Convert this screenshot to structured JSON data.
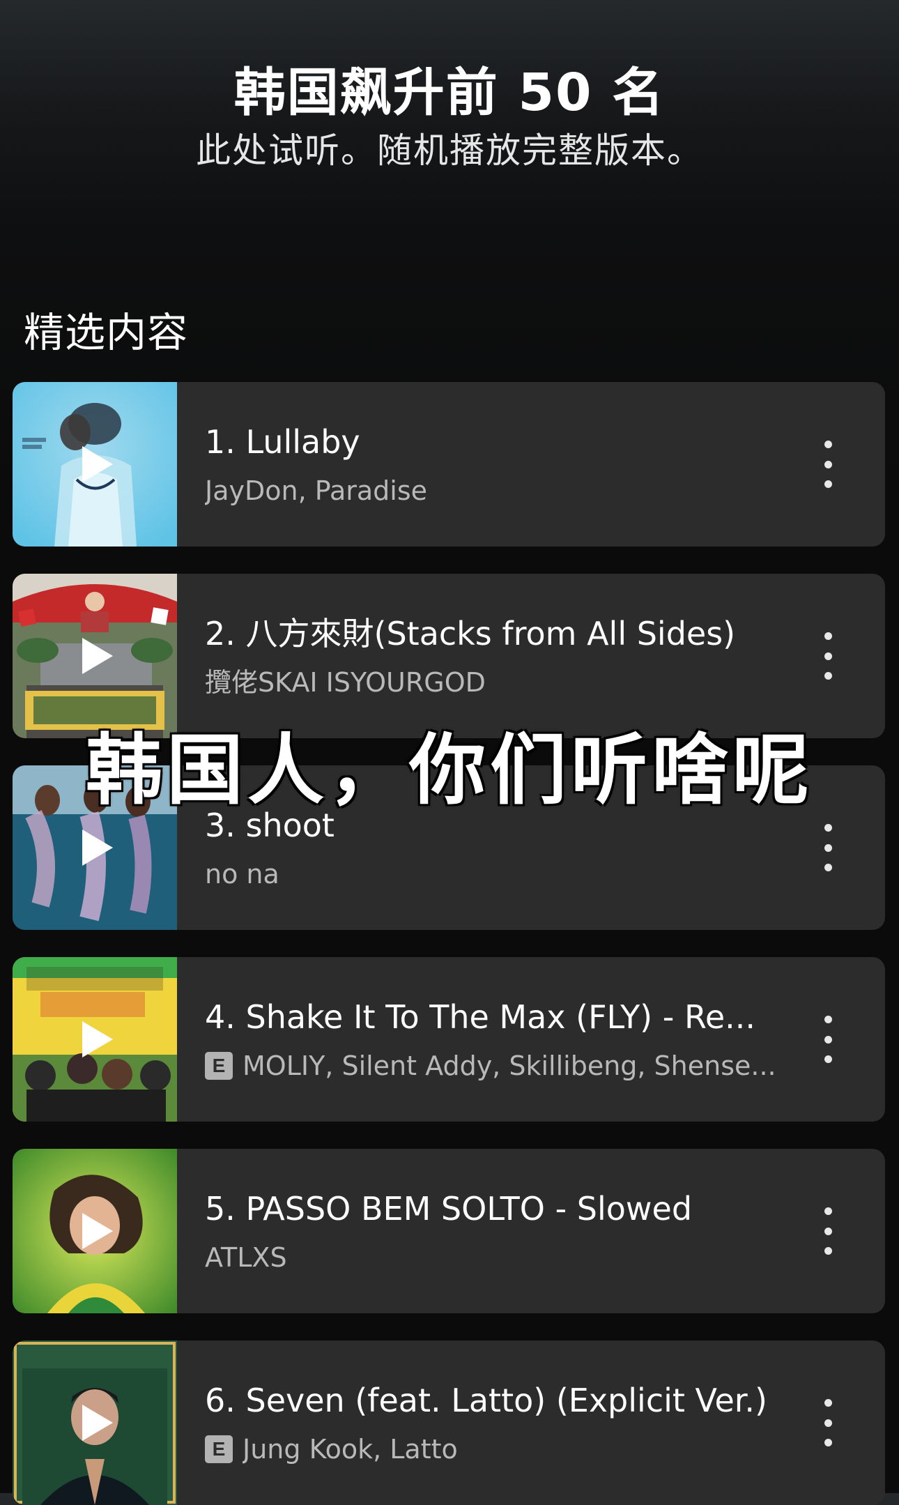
{
  "header": {
    "title": "韩国飙升前 50 名",
    "subtitle": "此处试听。随机播放完整版本。"
  },
  "section": {
    "title": "精选内容"
  },
  "tracks": [
    {
      "title": "1. Lullaby",
      "artist": "JayDon, Paradise",
      "explicit": false,
      "cover_icon": "album-cover-lullaby"
    },
    {
      "title": "2. 八方來財(Stacks from All Sides)",
      "artist": "攬佬SKAI ISYOURGOD",
      "explicit": false,
      "cover_icon": "album-cover-stacks"
    },
    {
      "title": "3. shoot",
      "artist": "no na",
      "explicit": false,
      "cover_icon": "album-cover-shoot"
    },
    {
      "title": "4. Shake It To The Max (FLY) - Re...",
      "artist": "MOLIY, Silent Addy, Skillibeng, Shense...",
      "explicit": true,
      "cover_icon": "album-cover-shake-it"
    },
    {
      "title": "5. PASSO BEM SOLTO - Slowed",
      "artist": "ATLXS",
      "explicit": false,
      "cover_icon": "album-cover-passo"
    },
    {
      "title": "6. Seven (feat. Latto) (Explicit Ver.)",
      "artist": "Jung Kook, Latto",
      "explicit": true,
      "cover_icon": "album-cover-golden"
    }
  ],
  "explicit_label": "E",
  "overlay": {
    "caption": "韩国人，你们听啥呢"
  },
  "colors": {
    "card_background": "#2c2c2c",
    "page_background": "#0b0b0b",
    "secondary_text": "#b9b9b9"
  }
}
